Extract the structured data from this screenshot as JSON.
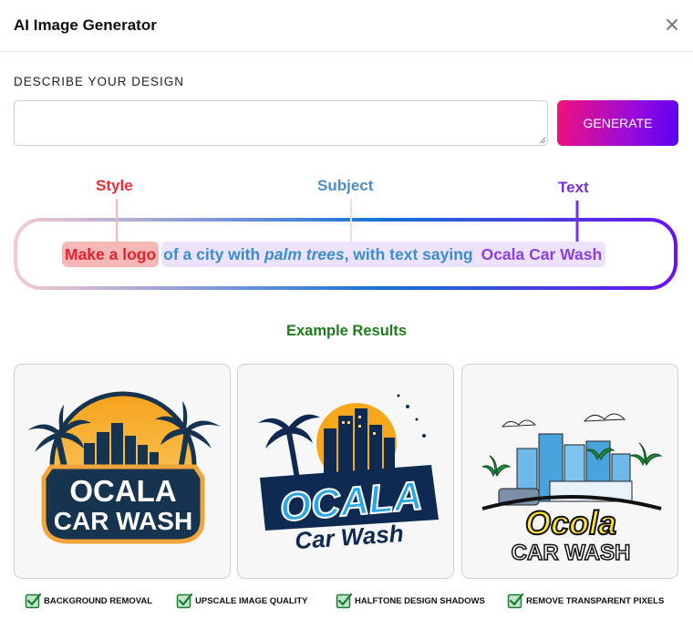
{
  "dialog": {
    "title": "AI Image Generator",
    "close_icon": "close-icon"
  },
  "prompt": {
    "label": "DESCRIBE YOUR DESIGN",
    "value": "",
    "placeholder": "",
    "generate_label": "GENERATE",
    "generate_gradient": [
      "#f2117a",
      "#5a00f5"
    ]
  },
  "anatomy": {
    "style_label": "Style",
    "subject_label": "Subject",
    "text_label": "Text",
    "style_phrase": "Make a logo",
    "subject_phrase_1": "of a city with ",
    "subject_phrase_2": "palm trees",
    "subject_phrase_3": ", with text saying",
    "text_phrase": "Ocala Car Wash",
    "colors": {
      "style": "#ef2c35",
      "subject": "#4a8ec9",
      "text": "#7a2fe0"
    }
  },
  "examples": {
    "title": "Example Results",
    "results": [
      {
        "line1": "OCALA",
        "line2": "CAR WASH"
      },
      {
        "line1": "OCALA",
        "line2": "Car Wash"
      },
      {
        "line1": "Ocola",
        "line2": "CAR WASH"
      }
    ]
  },
  "features": [
    {
      "label": "BACKGROUND REMOVAL",
      "icon": "checkbox-checked-icon"
    },
    {
      "label": "UPSCALE IMAGE QUALITY",
      "icon": "checkbox-checked-icon"
    },
    {
      "label": "HALFTONE DESIGN SHADOWS",
      "icon": "checkbox-checked-icon"
    },
    {
      "label": "REMOVE TRANSPARENT PIXELS",
      "icon": "checkbox-checked-icon"
    }
  ]
}
